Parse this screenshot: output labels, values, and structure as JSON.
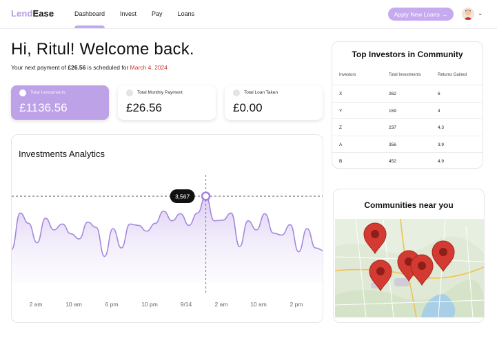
{
  "brand": {
    "part1": "Lend",
    "part2": "Ease"
  },
  "nav": [
    {
      "label": "Dashboard",
      "active": true
    },
    {
      "label": "Invest",
      "active": false
    },
    {
      "label": "Pay",
      "active": false
    },
    {
      "label": "Loans",
      "active": false
    }
  ],
  "cta": {
    "label": "Apply New Loans",
    "arrow": "→"
  },
  "greeting": {
    "title": "Hi, Ritul! Welcome back.",
    "sub_prefix": "Your next payment of ",
    "amount": "£26.56",
    "sub_mid": " is scheduled for ",
    "date": "March 4, 2024"
  },
  "stats": [
    {
      "label": "Total Investments",
      "value": "£1136.56"
    },
    {
      "label": "Total Monthly Payment",
      "value": "£26.56"
    },
    {
      "label": "Total Loan Taken",
      "value": "£0.00"
    }
  ],
  "analytics": {
    "title": "Investments Analytics",
    "tooltip": "3,567",
    "x_labels": [
      "2 am",
      "10 am",
      "6 pm",
      "10 pm",
      "9/14",
      "2 am",
      "10 am",
      "2 pm"
    ]
  },
  "chart_data": {
    "type": "area",
    "values": [
      0.18,
      0.74,
      0.58,
      0.28,
      0.66,
      0.48,
      0.57,
      0.42,
      0.34,
      0.6,
      0.52,
      0.07,
      0.5,
      0.2,
      0.57,
      0.55,
      0.46,
      0.58,
      0.77,
      0.62,
      0.73,
      0.55,
      0.74,
      1.0,
      0.62,
      0.63,
      0.74,
      0.22,
      0.62,
      0.48,
      0.73,
      0.43,
      0.4,
      0.56,
      0.14,
      0.5,
      0.2,
      0.16
    ],
    "highlight_index": 23,
    "highlight_label": "3,567",
    "x_tick_labels": [
      "2 am",
      "10 am",
      "6 pm",
      "10 pm",
      "9/14",
      "2 am",
      "10 am",
      "2 pm"
    ],
    "grid": false
  },
  "investors": {
    "title": "Top Investors in Community",
    "headers": [
      "Investors",
      "Total Investments",
      "Returns Gained"
    ],
    "rows": [
      [
        "X",
        "262",
        "6"
      ],
      [
        "Y",
        "159",
        "4"
      ],
      [
        "Z",
        "237",
        "4.3"
      ],
      [
        "A",
        "356",
        "3.9"
      ],
      [
        "B",
        "452",
        "4.9"
      ]
    ]
  },
  "communities": {
    "title": "Communities near you"
  },
  "colors": {
    "accent": "#c6aaf0",
    "accent_dark": "#9f7ee0",
    "date_red": "#d0342c",
    "pin_red": "#d23a32"
  }
}
